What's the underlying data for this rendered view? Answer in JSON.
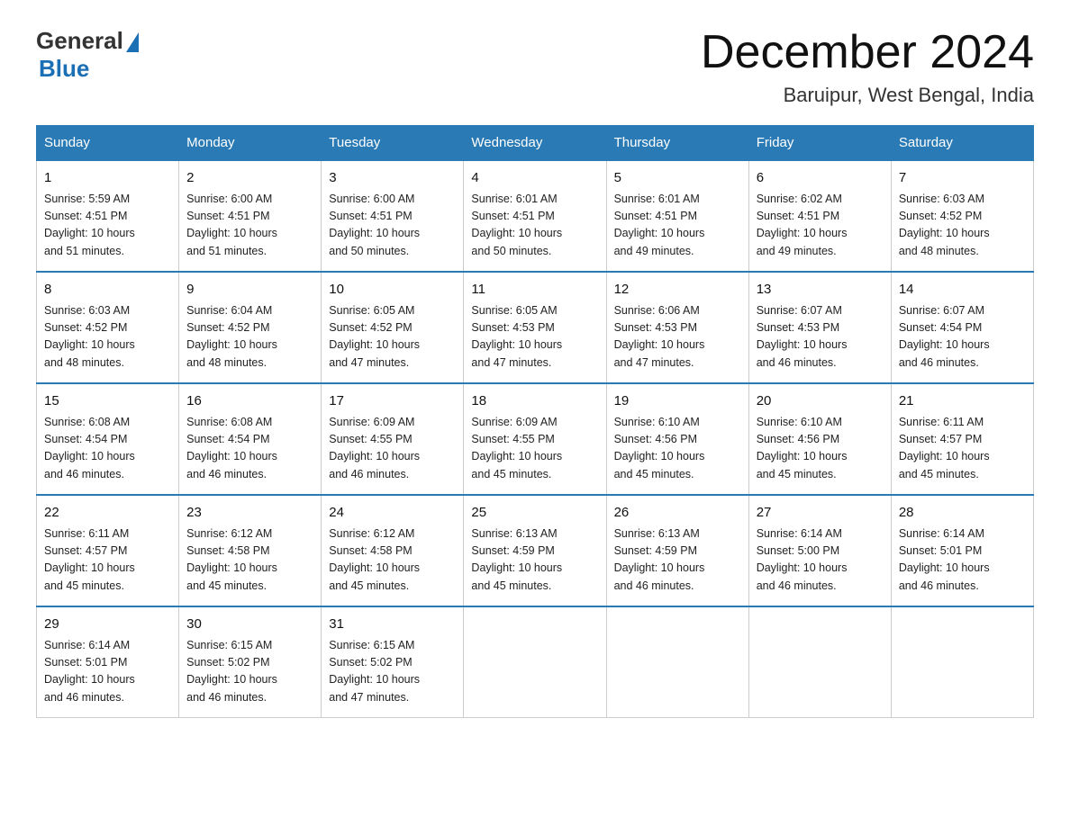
{
  "header": {
    "logo_general": "General",
    "logo_blue": "Blue",
    "month_title": "December 2024",
    "location": "Baruipur, West Bengal, India"
  },
  "days_of_week": [
    "Sunday",
    "Monday",
    "Tuesday",
    "Wednesday",
    "Thursday",
    "Friday",
    "Saturday"
  ],
  "weeks": [
    [
      {
        "num": "1",
        "info": "Sunrise: 5:59 AM\nSunset: 4:51 PM\nDaylight: 10 hours\nand 51 minutes."
      },
      {
        "num": "2",
        "info": "Sunrise: 6:00 AM\nSunset: 4:51 PM\nDaylight: 10 hours\nand 51 minutes."
      },
      {
        "num": "3",
        "info": "Sunrise: 6:00 AM\nSunset: 4:51 PM\nDaylight: 10 hours\nand 50 minutes."
      },
      {
        "num": "4",
        "info": "Sunrise: 6:01 AM\nSunset: 4:51 PM\nDaylight: 10 hours\nand 50 minutes."
      },
      {
        "num": "5",
        "info": "Sunrise: 6:01 AM\nSunset: 4:51 PM\nDaylight: 10 hours\nand 49 minutes."
      },
      {
        "num": "6",
        "info": "Sunrise: 6:02 AM\nSunset: 4:51 PM\nDaylight: 10 hours\nand 49 minutes."
      },
      {
        "num": "7",
        "info": "Sunrise: 6:03 AM\nSunset: 4:52 PM\nDaylight: 10 hours\nand 48 minutes."
      }
    ],
    [
      {
        "num": "8",
        "info": "Sunrise: 6:03 AM\nSunset: 4:52 PM\nDaylight: 10 hours\nand 48 minutes."
      },
      {
        "num": "9",
        "info": "Sunrise: 6:04 AM\nSunset: 4:52 PM\nDaylight: 10 hours\nand 48 minutes."
      },
      {
        "num": "10",
        "info": "Sunrise: 6:05 AM\nSunset: 4:52 PM\nDaylight: 10 hours\nand 47 minutes."
      },
      {
        "num": "11",
        "info": "Sunrise: 6:05 AM\nSunset: 4:53 PM\nDaylight: 10 hours\nand 47 minutes."
      },
      {
        "num": "12",
        "info": "Sunrise: 6:06 AM\nSunset: 4:53 PM\nDaylight: 10 hours\nand 47 minutes."
      },
      {
        "num": "13",
        "info": "Sunrise: 6:07 AM\nSunset: 4:53 PM\nDaylight: 10 hours\nand 46 minutes."
      },
      {
        "num": "14",
        "info": "Sunrise: 6:07 AM\nSunset: 4:54 PM\nDaylight: 10 hours\nand 46 minutes."
      }
    ],
    [
      {
        "num": "15",
        "info": "Sunrise: 6:08 AM\nSunset: 4:54 PM\nDaylight: 10 hours\nand 46 minutes."
      },
      {
        "num": "16",
        "info": "Sunrise: 6:08 AM\nSunset: 4:54 PM\nDaylight: 10 hours\nand 46 minutes."
      },
      {
        "num": "17",
        "info": "Sunrise: 6:09 AM\nSunset: 4:55 PM\nDaylight: 10 hours\nand 46 minutes."
      },
      {
        "num": "18",
        "info": "Sunrise: 6:09 AM\nSunset: 4:55 PM\nDaylight: 10 hours\nand 45 minutes."
      },
      {
        "num": "19",
        "info": "Sunrise: 6:10 AM\nSunset: 4:56 PM\nDaylight: 10 hours\nand 45 minutes."
      },
      {
        "num": "20",
        "info": "Sunrise: 6:10 AM\nSunset: 4:56 PM\nDaylight: 10 hours\nand 45 minutes."
      },
      {
        "num": "21",
        "info": "Sunrise: 6:11 AM\nSunset: 4:57 PM\nDaylight: 10 hours\nand 45 minutes."
      }
    ],
    [
      {
        "num": "22",
        "info": "Sunrise: 6:11 AM\nSunset: 4:57 PM\nDaylight: 10 hours\nand 45 minutes."
      },
      {
        "num": "23",
        "info": "Sunrise: 6:12 AM\nSunset: 4:58 PM\nDaylight: 10 hours\nand 45 minutes."
      },
      {
        "num": "24",
        "info": "Sunrise: 6:12 AM\nSunset: 4:58 PM\nDaylight: 10 hours\nand 45 minutes."
      },
      {
        "num": "25",
        "info": "Sunrise: 6:13 AM\nSunset: 4:59 PM\nDaylight: 10 hours\nand 45 minutes."
      },
      {
        "num": "26",
        "info": "Sunrise: 6:13 AM\nSunset: 4:59 PM\nDaylight: 10 hours\nand 46 minutes."
      },
      {
        "num": "27",
        "info": "Sunrise: 6:14 AM\nSunset: 5:00 PM\nDaylight: 10 hours\nand 46 minutes."
      },
      {
        "num": "28",
        "info": "Sunrise: 6:14 AM\nSunset: 5:01 PM\nDaylight: 10 hours\nand 46 minutes."
      }
    ],
    [
      {
        "num": "29",
        "info": "Sunrise: 6:14 AM\nSunset: 5:01 PM\nDaylight: 10 hours\nand 46 minutes."
      },
      {
        "num": "30",
        "info": "Sunrise: 6:15 AM\nSunset: 5:02 PM\nDaylight: 10 hours\nand 46 minutes."
      },
      {
        "num": "31",
        "info": "Sunrise: 6:15 AM\nSunset: 5:02 PM\nDaylight: 10 hours\nand 47 minutes."
      },
      null,
      null,
      null,
      null
    ]
  ]
}
